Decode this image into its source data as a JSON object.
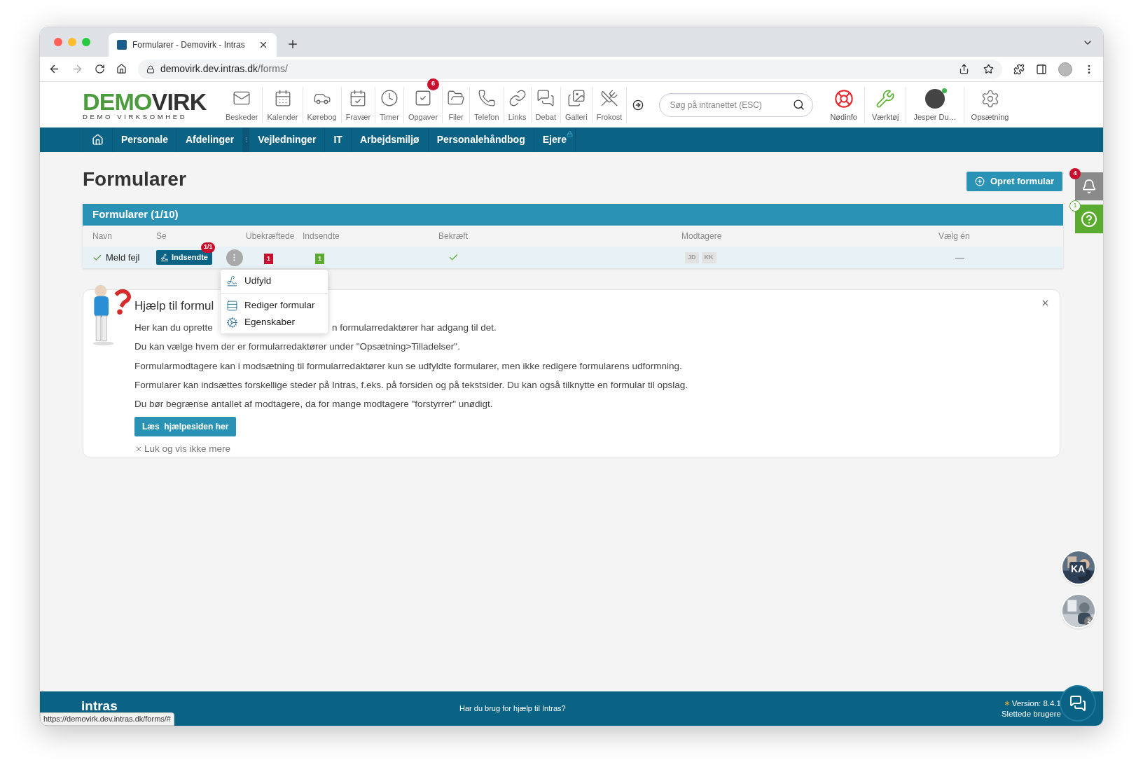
{
  "browser": {
    "tab_title": "Formularer - Demovirk - Intras",
    "url_host": "demovirk.dev.intras.dk",
    "url_path": "/forms/"
  },
  "header": {
    "logo": {
      "left": "DEMO",
      "right": "VIRK",
      "sub": "DEMO VIRKSOMHED"
    },
    "apps": [
      {
        "label": "Beskeder"
      },
      {
        "label": "Kalender"
      },
      {
        "label": "Kørebog"
      },
      {
        "label": "Fravær"
      },
      {
        "label": "Timer"
      },
      {
        "label": "Opgaver",
        "badge": "6"
      },
      {
        "label": "Filer"
      },
      {
        "label": "Telefon"
      },
      {
        "label": "Links"
      },
      {
        "label": "Debat"
      },
      {
        "label": "Galleri"
      },
      {
        "label": "Frokost"
      }
    ],
    "search": {
      "placeholder": "Søg på intranettet (ESC)"
    },
    "right_apps": [
      {
        "label": "Nødinfo"
      },
      {
        "label": "Værktøj"
      },
      {
        "label": "Jesper Du…",
        "online": true
      },
      {
        "label": "Opsætning"
      }
    ]
  },
  "nav": {
    "items": [
      {
        "label": "Personale",
        "locked": false
      },
      {
        "label": "Afdelinger",
        "locked": false
      },
      {
        "label": "Vejledninger",
        "locked": false
      },
      {
        "label": "IT",
        "locked": false
      },
      {
        "label": "Arbejdsmiljø",
        "locked": false
      },
      {
        "label": "Personalehåndbog",
        "locked": false
      },
      {
        "label": "Ejere",
        "locked": true
      }
    ]
  },
  "page": {
    "title": "Formularer",
    "create_button": "Opret formular"
  },
  "table": {
    "title": "Formularer (1/10)",
    "columns": [
      "Navn",
      "Se",
      "Ubekræftede",
      "Indsendte",
      "Bekræft",
      "Modtagere",
      "Vælg én"
    ],
    "rows": [
      {
        "active": true,
        "name": "Meld fejl",
        "see_button": "Indsendte",
        "see_badge": "1/1",
        "unconfirmed": "1",
        "submitted": "1",
        "confirmed": true,
        "recipients": [
          "JD",
          "KK"
        ],
        "choose": "—"
      }
    ]
  },
  "menu": {
    "items": [
      {
        "label": "Udfyld"
      },
      {
        "label": "Rediger formular"
      },
      {
        "label": "Egenskaber"
      }
    ]
  },
  "help": {
    "title": "Hjælp til formul",
    "first_line": [
      "Her kan du oprette",
      "n formularredaktører har adgang til det."
    ],
    "lines": [
      "Du kan vælge hvem der er formularredaktører under \"Opsætning>Tilladelser\".",
      "Formularmodtagere kan i modsætning til formularredaktører kun se udfyldte formularer, men ikke redigere formularens udformning.",
      "Formularer kan indsættes forskellige steder på Intras, f.eks. på forsiden og på tekstsider. Du kan også tilknytte en formular til opslag.",
      "Du bør begrænse antallet af modtagere, da for mange modtagere \"forstyrrer\" unødigt."
    ],
    "button": "Læs  hjælpesiden her",
    "dismiss": "Luk og vis ikke mere"
  },
  "side": {
    "notifications_badge": "4",
    "help_badge": "1"
  },
  "presence": [
    {
      "initials": "KA"
    },
    {
      "count": "2"
    }
  ],
  "footer": {
    "logo": "intras",
    "help": "Har du brug for hjælp til Intras?",
    "version": "Version: 8.4.1",
    "deleted_users": "Slettede brugere"
  },
  "status_url": "https://demovirk.dev.intras.dk/forms/#"
}
